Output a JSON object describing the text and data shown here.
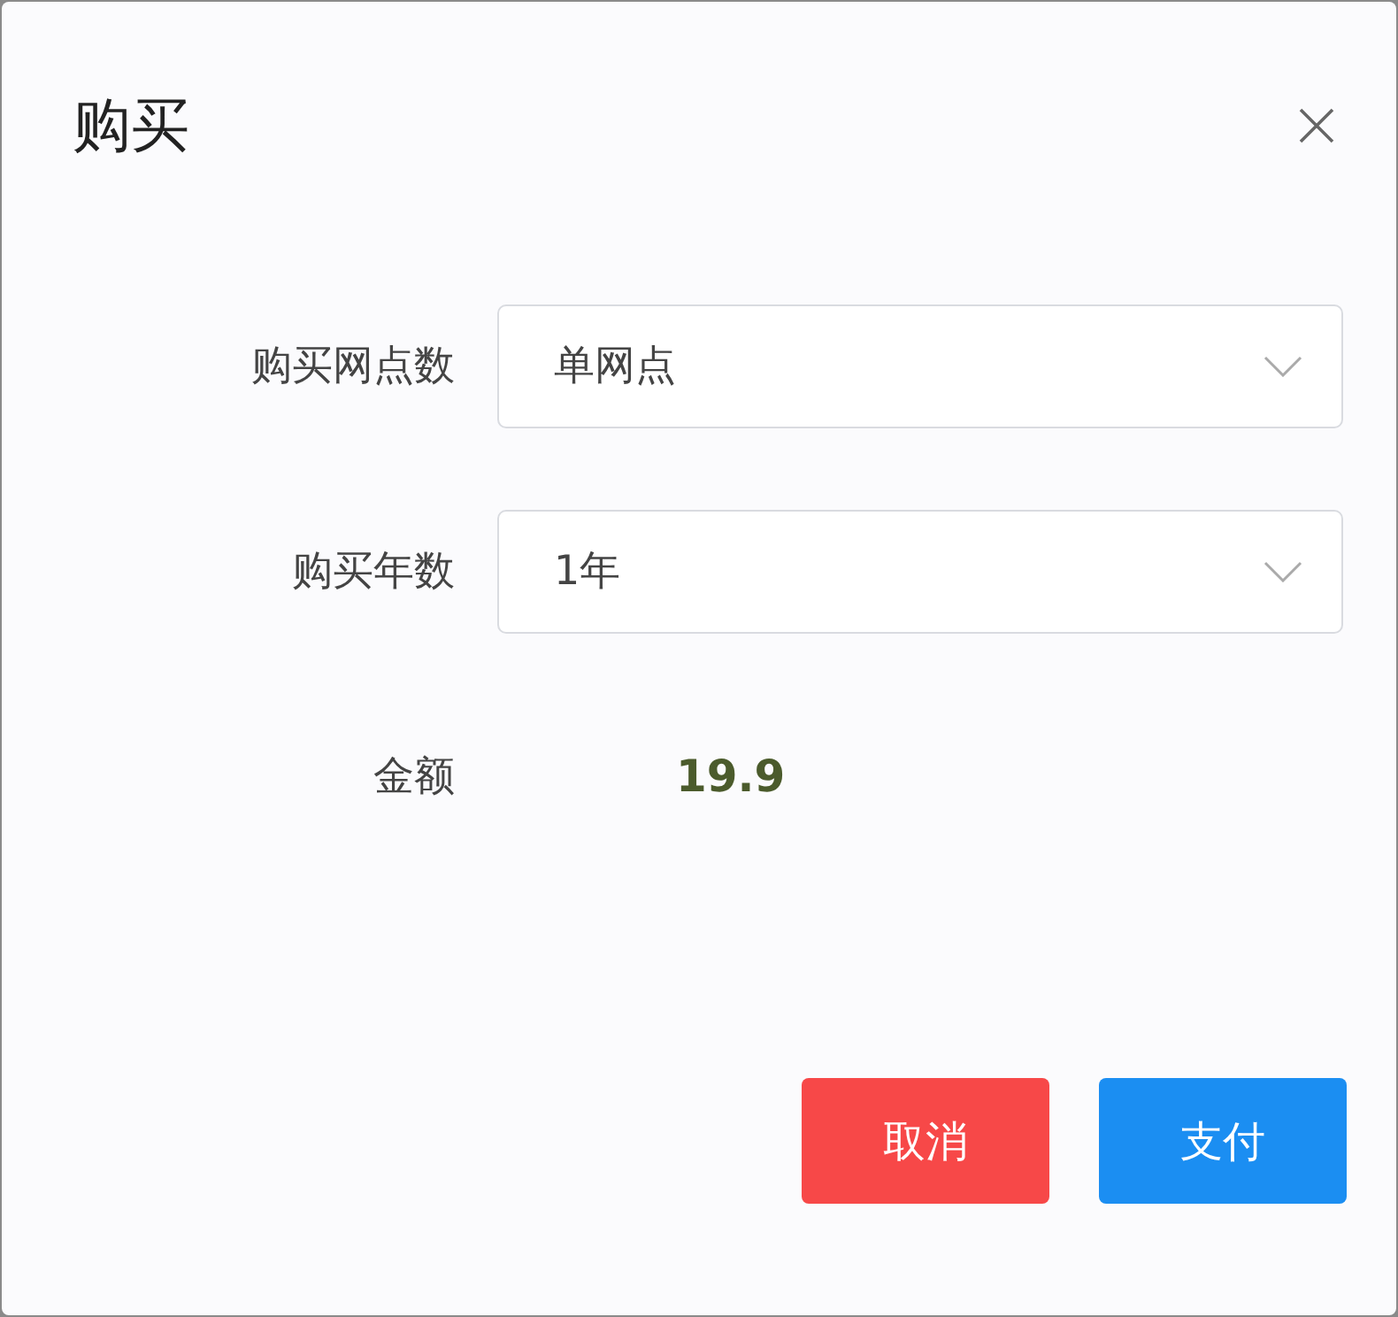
{
  "dialog": {
    "title": "购买"
  },
  "fields": [
    {
      "label": "购买网点数",
      "value": "单网点"
    },
    {
      "label": "购买年数",
      "value": "1年"
    }
  ],
  "amount": {
    "label": "金额",
    "value": "19.9"
  },
  "buttons": [
    {
      "label": "取消",
      "kind": "cancel"
    },
    {
      "label": "支付",
      "kind": "primary"
    }
  ]
}
